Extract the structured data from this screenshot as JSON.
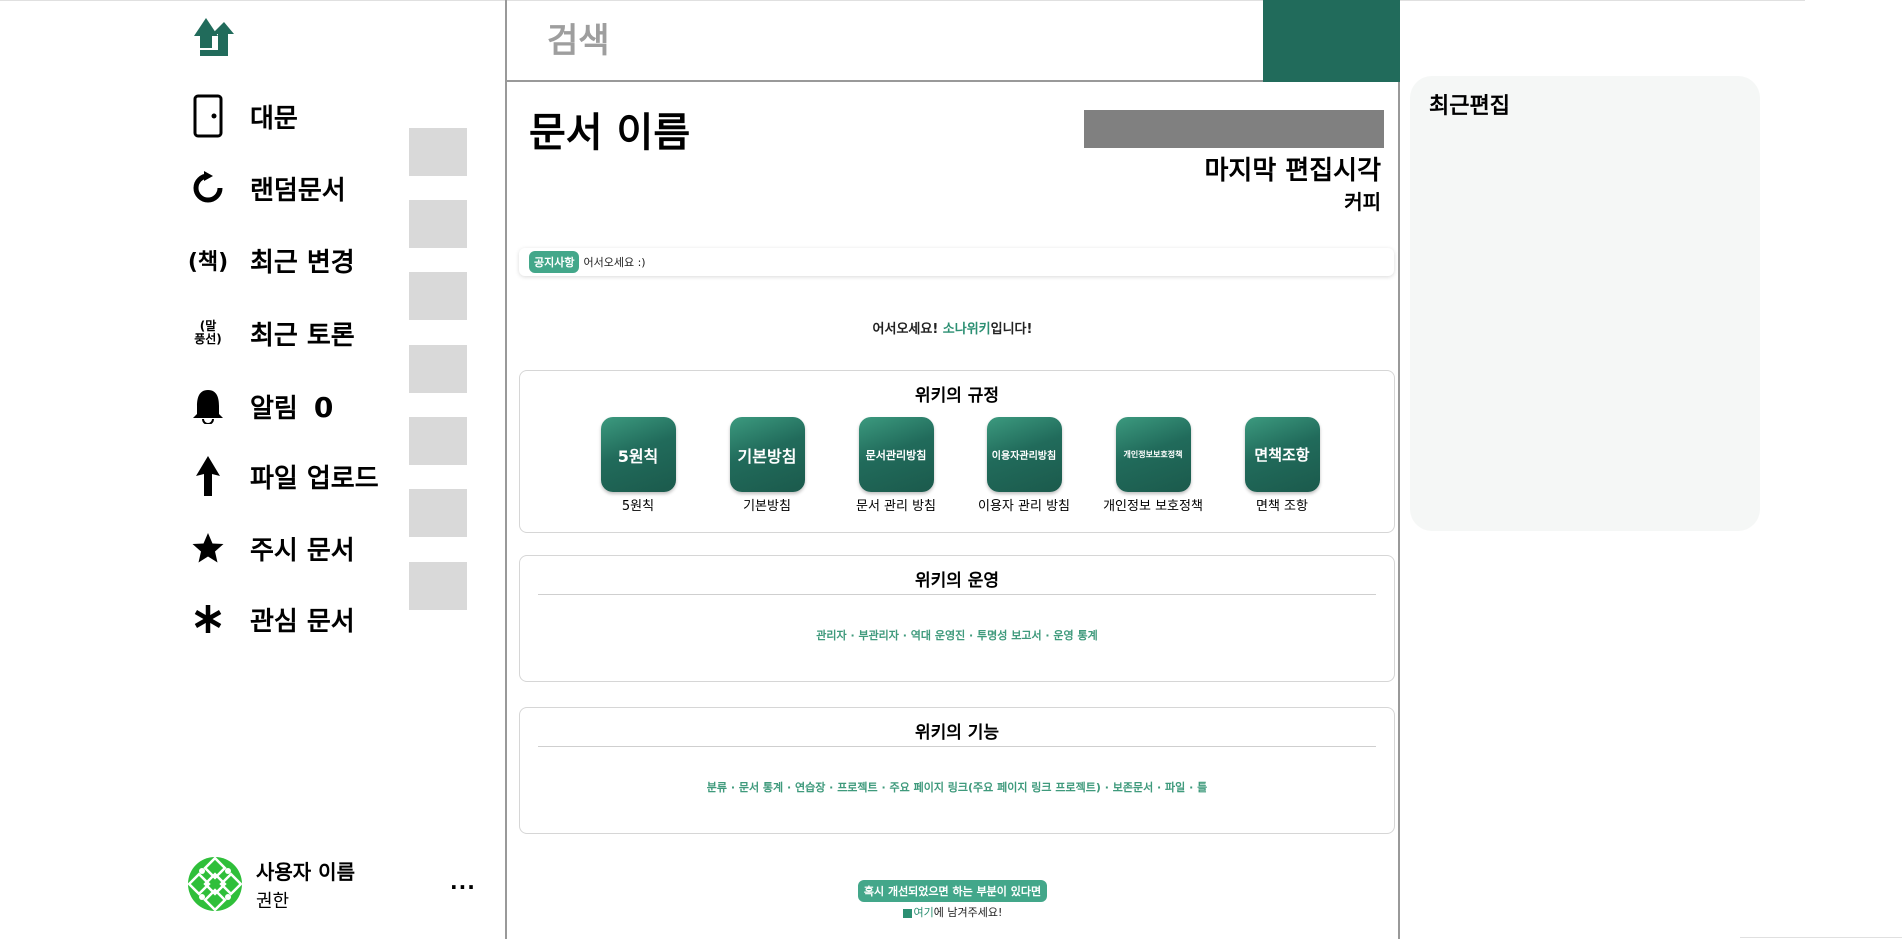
{
  "sidebar": {
    "items": [
      {
        "label": "대문",
        "icon": "door-icon"
      },
      {
        "label": "랜덤문서",
        "icon": "refresh-icon"
      },
      {
        "label": "최근 변경",
        "icon": "book-icon",
        "icon_text": "(책)"
      },
      {
        "label": "최근 토론",
        "icon": "speech-bubble-icon",
        "icon_text": "(말\n풍선)"
      },
      {
        "label": "알림",
        "icon": "bell-icon",
        "count": "0"
      },
      {
        "label": "파일 업로드",
        "icon": "upload-arrow-icon"
      },
      {
        "label": "주시 문서",
        "icon": "star-icon"
      },
      {
        "label": "관심 문서",
        "icon": "asterisk-icon"
      }
    ],
    "user": {
      "name": "사용자 이름",
      "role": "권한",
      "more": "..."
    }
  },
  "search": {
    "placeholder": "검색"
  },
  "document": {
    "title": "문서 이름",
    "last_edit_label": "마지막 편집시각",
    "last_editor": "커피"
  },
  "notice": {
    "tag": "공지사항",
    "text": "어서오세요 :)"
  },
  "welcome": {
    "prefix": "어서오세요! ",
    "wiki_name": "소나위키",
    "suffix": "입니다!"
  },
  "rules": {
    "title": "위키의 규정",
    "cards": [
      {
        "tile": "5원칙",
        "label": "5원칙"
      },
      {
        "tile": "기본방침",
        "label": "기본방침"
      },
      {
        "tile": "문서관리방침",
        "label": "문서 관리 방침"
      },
      {
        "tile": "이용자관리방침",
        "label": "이용자 관리 방침"
      },
      {
        "tile": "개인정보보호정책",
        "label": "개인정보 보호정책"
      },
      {
        "tile": "면책조항",
        "label": "면책 조항"
      }
    ]
  },
  "operations": {
    "title": "위키의 운영",
    "links": "관리자 · 부관리자 · 역대 운영진 · 투명성 보고서 · 운영 통계"
  },
  "features": {
    "title": "위키의 기능",
    "links": "분류 · 문서 통계 · 연습장 · 프로젝트 · 주요 페이지 링크(주요 페이지 링크 프로젝트) · 보존문서 · 파일 · 틀"
  },
  "feedback": {
    "tag": "혹시 개선되었으면 하는 부분이 있다면",
    "link": "여기",
    "suffix": "에 남겨주세요!"
  },
  "recent_panel": {
    "title": "최근편집"
  },
  "colors": {
    "brand": "#216b5b",
    "accent": "#43a78a",
    "link": "#3f9a7c"
  }
}
